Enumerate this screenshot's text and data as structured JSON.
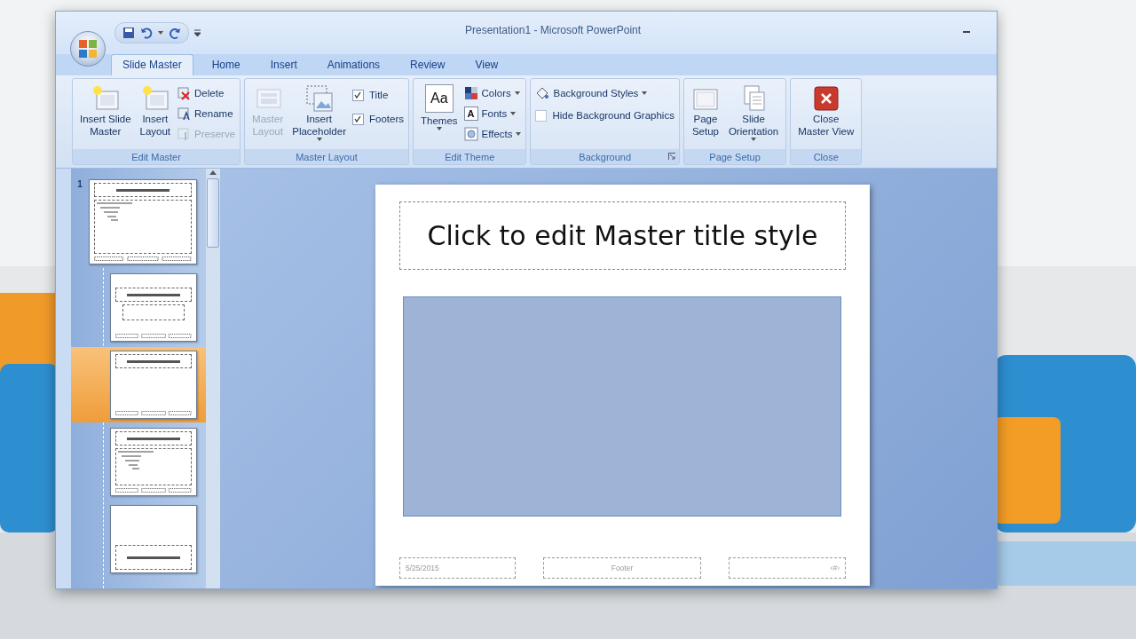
{
  "window": {
    "title": "Presentation1  -  Microsoft PowerPoint"
  },
  "tabs": [
    {
      "label": "Slide Master",
      "selected": true
    },
    {
      "label": "Home",
      "selected": false
    },
    {
      "label": "Insert",
      "selected": false
    },
    {
      "label": "Animations",
      "selected": false
    },
    {
      "label": "Review",
      "selected": false
    },
    {
      "label": "View",
      "selected": false
    }
  ],
  "ribbon": {
    "groups": [
      {
        "label": "Edit Master",
        "controls": [
          {
            "kind": "large",
            "label": "Insert Slide\nMaster",
            "disabled": false
          },
          {
            "kind": "large",
            "label": "Insert\nLayout",
            "disabled": false
          },
          {
            "kind": "small",
            "label": "Delete",
            "disabled": false
          },
          {
            "kind": "small",
            "label": "Rename",
            "disabled": false
          },
          {
            "kind": "small",
            "label": "Preserve",
            "disabled": true
          }
        ]
      },
      {
        "label": "Master Layout",
        "controls": [
          {
            "kind": "large",
            "label": "Master\nLayout",
            "disabled": true
          },
          {
            "kind": "large",
            "label": "Insert\nPlaceholder",
            "disabled": false,
            "dropdown": true
          },
          {
            "kind": "check",
            "label": "Title",
            "checked": true
          },
          {
            "kind": "check",
            "label": "Footers",
            "checked": true
          }
        ]
      },
      {
        "label": "Edit Theme",
        "controls": [
          {
            "kind": "large",
            "label": "Themes",
            "icon_text": "Aa",
            "disabled": false,
            "dropdown": true
          },
          {
            "kind": "small",
            "label": "Colors",
            "disabled": false,
            "dropdown": true
          },
          {
            "kind": "small",
            "label": "Fonts",
            "icon_text": "A",
            "disabled": false,
            "dropdown": true
          },
          {
            "kind": "small",
            "label": "Effects",
            "disabled": false,
            "dropdown": true
          }
        ]
      },
      {
        "label": "Background",
        "launcher": true,
        "controls": [
          {
            "kind": "small",
            "label": "Background Styles",
            "disabled": false,
            "dropdown": true
          },
          {
            "kind": "check",
            "label": "Hide Background Graphics",
            "checked": false
          }
        ]
      },
      {
        "label": "Page Setup",
        "controls": [
          {
            "kind": "large",
            "label": "Page\nSetup",
            "disabled": false
          },
          {
            "kind": "large",
            "label": "Slide\nOrientation",
            "disabled": false,
            "dropdown": true
          }
        ]
      },
      {
        "label": "Close",
        "controls": [
          {
            "kind": "large",
            "label": "Close\nMaster View",
            "disabled": false
          }
        ]
      }
    ]
  },
  "thumbnails": [
    {
      "kind": "master",
      "number": "1",
      "selected": false
    },
    {
      "kind": "title",
      "selected": false
    },
    {
      "kind": "title-only",
      "selected": true
    },
    {
      "kind": "content",
      "selected": false
    },
    {
      "kind": "section",
      "selected": false
    }
  ],
  "slide": {
    "title": "Click to edit Master title style",
    "footers": [
      "5/25/2015",
      "Footer",
      "‹#›"
    ]
  }
}
